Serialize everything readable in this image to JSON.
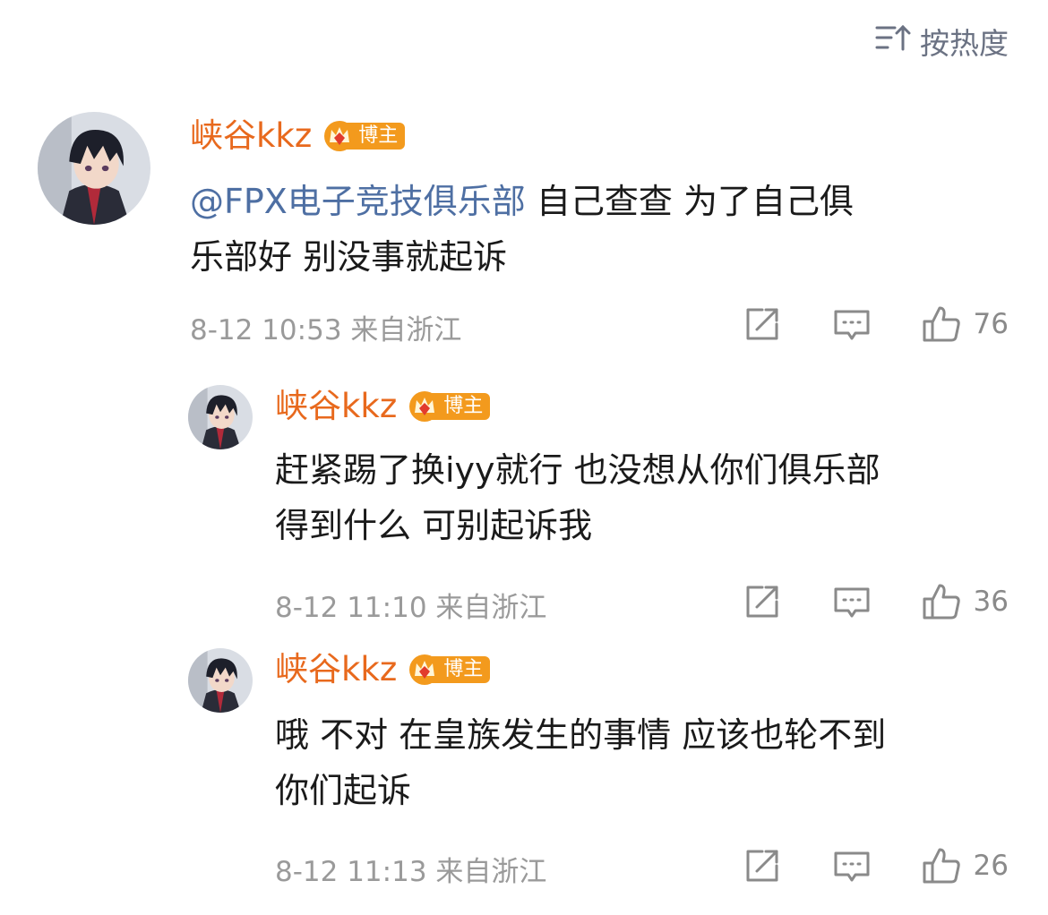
{
  "sort": {
    "label": "按热度"
  },
  "colors": {
    "username": "#e8691d",
    "badge": "#f39a1d",
    "mention": "#4e6fa3",
    "meta": "#9a9a9a"
  },
  "comments": [
    {
      "user": "峡谷kkz",
      "badge": "博主",
      "mention": "@FPX电子竞技俱乐部",
      "line1": "自己查查 为了自己俱",
      "line2": "乐部好 别没事就起诉",
      "time": "8-12 10:53",
      "location": "来自浙江",
      "likes": "76"
    },
    {
      "user": "峡谷kkz",
      "badge": "博主",
      "line1": "赶紧踢了换iyy就行 也没想从你们俱乐部",
      "line2": "得到什么 可别起诉我",
      "time": "8-12 11:10",
      "location": "来自浙江",
      "likes": "36"
    },
    {
      "user": "峡谷kkz",
      "badge": "博主",
      "line1": "哦 不对 在皇族发生的事情 应该也轮不到",
      "line2": "你们起诉",
      "time": "8-12 11:13",
      "location": "来自浙江",
      "likes": "26"
    }
  ]
}
